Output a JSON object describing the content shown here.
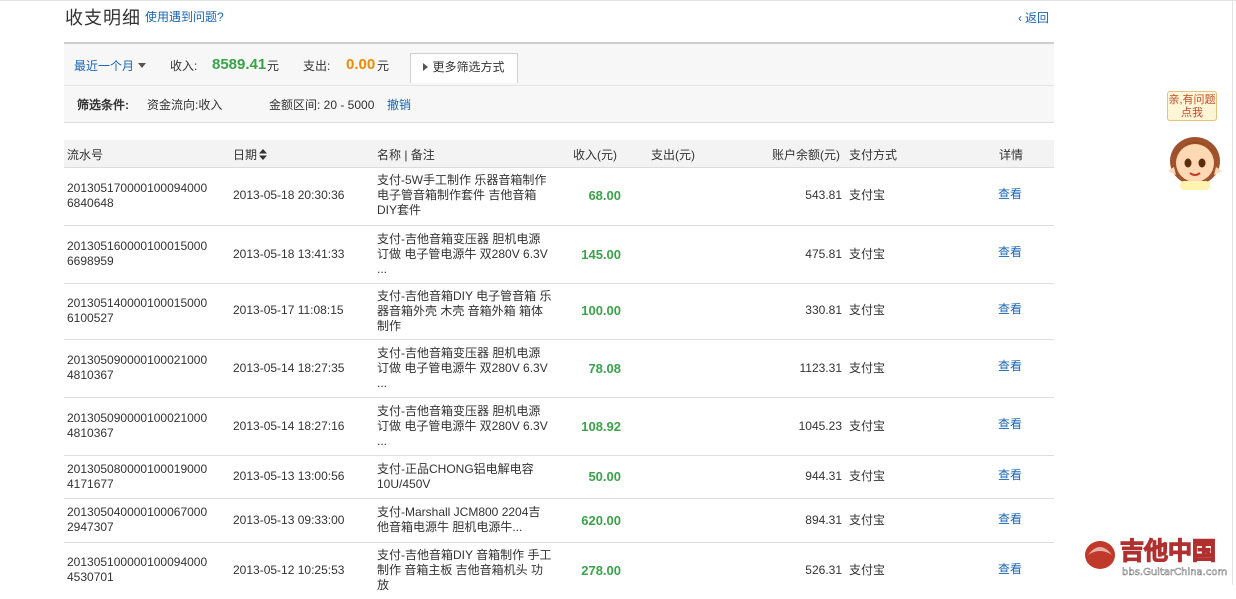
{
  "header": {
    "title": "收支明细",
    "help_link": "使用遇到问题?",
    "back_link": "返回"
  },
  "filter": {
    "range": "最近一个月",
    "income_label": "收入:",
    "income_value": "8589.41",
    "income_unit": "元",
    "expense_label": "支出:",
    "expense_value": "0.00",
    "expense_unit": "元",
    "more_button": "更多筛选方式",
    "conditions_label": "筛选条件:",
    "condition_direction": "资金流向:收入",
    "condition_amount": "金额区间: 20 - 5000",
    "cancel": "撤销"
  },
  "table": {
    "columns": {
      "id": "流水号",
      "date": "日期",
      "name": "名称 | 备注",
      "income": "收入(元)",
      "expense": "支出(元)",
      "balance": "账户余额(元)",
      "method": "支付方式",
      "detail": "详情"
    },
    "rows": [
      {
        "id": "201305170000100094000 6840648",
        "date": "2013-05-18 20:30:36",
        "name": "支付-5W手工制作 乐器音箱制作 电子管音箱制作套件 吉他音箱DIY套件",
        "income": "68.00",
        "balance": "543.81",
        "method": "支付宝",
        "detail": "查看"
      },
      {
        "id": "201305160000100015000 6698959",
        "date": "2013-05-18 13:41:33",
        "name": "支付-吉他音箱变压器 胆机电源订做 电子管电源牛 双280V 6.3V ...",
        "income": "145.00",
        "balance": "475.81",
        "method": "支付宝",
        "detail": "查看"
      },
      {
        "id": "201305140000100015000 6100527",
        "date": "2013-05-17 11:08:15",
        "name": "支付-吉他音箱DIY 电子管音箱 乐器音箱外壳 木壳 音箱外箱 箱体制作",
        "income": "100.00",
        "balance": "330.81",
        "method": "支付宝",
        "detail": "查看"
      },
      {
        "id": "201305090000100021000 4810367",
        "date": "2013-05-14 18:27:35",
        "name": "支付-吉他音箱变压器 胆机电源订做 电子管电源牛 双280V 6.3V ...",
        "income": "78.08",
        "balance": "1123.31",
        "method": "支付宝",
        "detail": "查看"
      },
      {
        "id": "201305090000100021000 4810367",
        "date": "2013-05-14 18:27:16",
        "name": "支付-吉他音箱变压器 胆机电源订做 电子管电源牛 双280V 6.3V ...",
        "income": "108.92",
        "balance": "1045.23",
        "method": "支付宝",
        "detail": "查看"
      },
      {
        "id": "201305080000100019000 4171677",
        "date": "2013-05-13 13:00:56",
        "name": "支付-正品CHONG铝电解电容 10U/450V",
        "income": "50.00",
        "balance": "944.31",
        "method": "支付宝",
        "detail": "查看"
      },
      {
        "id": "201305040000100067000 2947307",
        "date": "2013-05-13 09:33:00",
        "name": "支付-Marshall JCM800 2204吉他音箱电源牛 胆机电源牛...",
        "income": "620.00",
        "balance": "894.31",
        "method": "支付宝",
        "detail": "查看"
      },
      {
        "id": "201305100000100094000 4530701",
        "date": "2013-05-12 10:25:53",
        "name": "支付-吉他音箱DIY 音箱制作 手工制作 音箱主板 吉他音箱机头 功放",
        "income": "278.00",
        "balance": "526.31",
        "method": "支付宝",
        "detail": "查看"
      }
    ]
  },
  "side_widget": {
    "bubble": "亲,有问题点我"
  },
  "watermark": {
    "text": "吉他中国",
    "url": "bbs.GuitarChina.com"
  },
  "colors": {
    "income": "#3aa34a",
    "expense": "#f08a00",
    "link": "#1a66b3"
  }
}
